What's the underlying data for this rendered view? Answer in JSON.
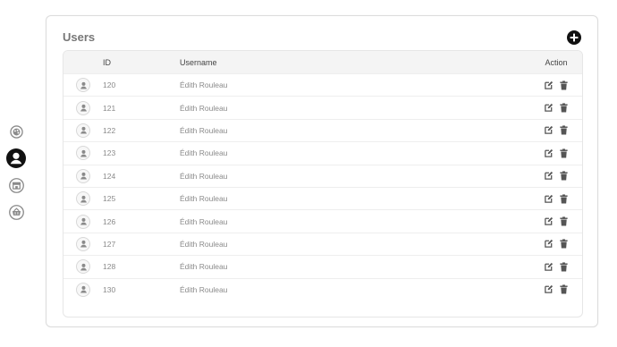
{
  "colors": {
    "accent": "#111111",
    "nav_icon": "#8a8a8a",
    "action_icon": "#555555"
  },
  "sidebar": {
    "items": [
      {
        "name": "dashboard",
        "icon": "palette-icon",
        "active": false
      },
      {
        "name": "users",
        "icon": "user-circle-icon",
        "active": true
      },
      {
        "name": "stores",
        "icon": "store-icon",
        "active": false
      },
      {
        "name": "baskets",
        "icon": "basket-icon",
        "active": false
      }
    ]
  },
  "card": {
    "title": "Users",
    "add_icon": "plus-circle-icon"
  },
  "table": {
    "headers": {
      "id": "ID",
      "username": "Username",
      "action": "Action"
    },
    "rows": [
      {
        "id": "120",
        "username": "Édith Rouleau"
      },
      {
        "id": "121",
        "username": "Édith Rouleau"
      },
      {
        "id": "122",
        "username": "Édith Rouleau"
      },
      {
        "id": "123",
        "username": "Édith Rouleau"
      },
      {
        "id": "124",
        "username": "Édith Rouleau"
      },
      {
        "id": "125",
        "username": "Édith Rouleau"
      },
      {
        "id": "126",
        "username": "Édith Rouleau"
      },
      {
        "id": "127",
        "username": "Édith Rouleau"
      },
      {
        "id": "128",
        "username": "Édith Rouleau"
      },
      {
        "id": "130",
        "username": "Édith Rouleau"
      }
    ],
    "row_icons": {
      "avatar": "user-avatar-icon",
      "edit": "edit-icon",
      "delete": "trash-icon"
    }
  }
}
